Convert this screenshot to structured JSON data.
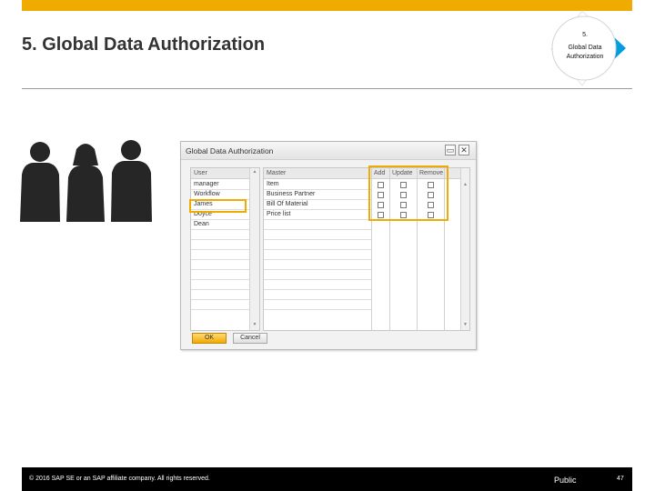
{
  "slide": {
    "title": "5. Global Data Authorization",
    "badge_number": "5.",
    "badge_label": "Global Data Authorization",
    "accent_color": "#f0ab00"
  },
  "dialog": {
    "title": "Global Data Authorization",
    "user_header": "User",
    "users": [
      "manager",
      "Workflow",
      "James",
      "Doyce",
      "Dean"
    ],
    "selected_user": "James",
    "master_header": "Master",
    "masters": [
      "Item",
      "Business Partner",
      "Bill Of Material",
      "Price list"
    ],
    "permission_headers": [
      "Add",
      "Update",
      "Remove"
    ],
    "permissions": [
      [
        false,
        false,
        false
      ],
      [
        false,
        false,
        false
      ],
      [
        false,
        false,
        false
      ],
      [
        false,
        false,
        false
      ]
    ],
    "ok_label": "OK",
    "cancel_label": "Cancel",
    "minimize_glyph": "▭",
    "close_glyph": "✕"
  },
  "footer": {
    "copyright": "© 2016 SAP SE or an SAP affiliate company. All rights reserved.",
    "classification": "Public",
    "page_number": "47"
  },
  "icons": [
    "people-silhouette-icon",
    "step-badge-icon",
    "minimize-icon",
    "close-icon",
    "scroll-up-icon",
    "scroll-down-icon"
  ]
}
